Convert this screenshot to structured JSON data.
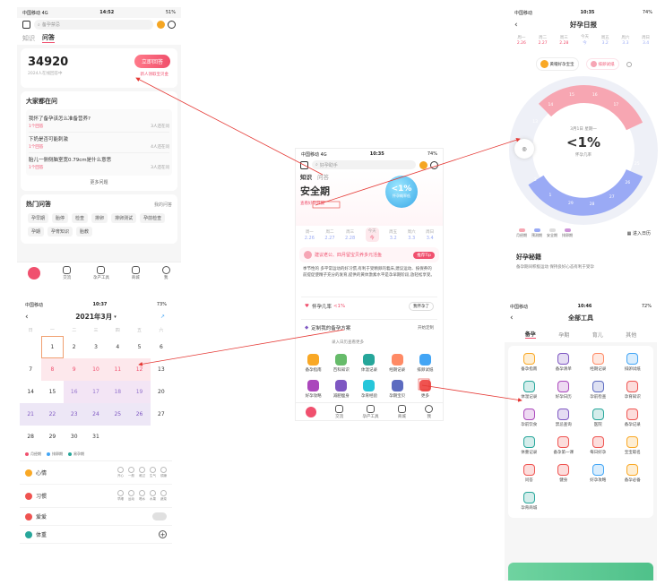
{
  "s1": {
    "status": {
      "carrier": "中国移动 4G",
      "time": "14:52",
      "battery": "51%"
    },
    "search_placeholder": "备孕禁忌",
    "tabs": [
      "知识",
      "问答"
    ],
    "count": "34920",
    "count_sub": "2024人在线回答中",
    "answer_btn": "立即回答",
    "answer_sub": "新人领取宝贝金",
    "ask_title": "大家都在问",
    "questions": [
      {
        "q": "我怀了备孕该怎么准备营养?",
        "meta": "1个回答",
        "tag": "3人还在问"
      },
      {
        "q": "下奶是否可能刺激",
        "meta": "1个回答",
        "tag": "4人还在问"
      },
      {
        "q": "胎儿一侧侧脑室宽0.79cm是什么意思",
        "meta": "1个回答",
        "tag": "3人还在问"
      }
    ],
    "more": "更多问题",
    "hot_title": "热门问答",
    "hot_link": "我的问答",
    "hot_tags": [
      "孕早期",
      "胎停",
      "检查",
      "排卵",
      "排卵测试",
      "孕前检查",
      "孕期",
      "孕育知识",
      "胎教"
    ],
    "tabbar": [
      "交流",
      "孕产工具",
      "商城",
      "我"
    ]
  },
  "s2": {
    "status": {
      "carrier": "中国移动 4G",
      "time": "10:35",
      "battery": "74%"
    },
    "search_placeholder": "好孕助手",
    "tabs": [
      "知识",
      "问答"
    ],
    "phase": "安全期",
    "phase_link": "查看好孕日报",
    "prob": "<1%",
    "prob_sub": "怀孕概率低",
    "dates": [
      {
        "d": "2.26",
        "w": "周一"
      },
      {
        "d": "2.27",
        "w": "周二"
      },
      {
        "d": "2.28",
        "w": "周三"
      },
      {
        "d": "今",
        "w": "今天"
      },
      {
        "d": "3.2",
        "w": "周五"
      },
      {
        "d": "3.3",
        "w": "周六"
      },
      {
        "d": "3.4",
        "w": "周日"
      }
    ],
    "tip": "建议老公、四月留宝贝养多元活鱼",
    "tip_btn": "推荐Tip",
    "article": "季节性的 多平常运动的好习惯,有利于受精卵的着床,建议运动、按保养的前提促使精子充分的发育,提供的黄体激素水平是孕早期阶段,放轻松享受。",
    "row1": {
      "label": "怀孕几率",
      "val": "<1%",
      "btn": "我怀孕了"
    },
    "row2": {
      "label": "定制我的备孕方案",
      "btn": "开始定制"
    },
    "note": "录入日历查看更多",
    "tools": [
      {
        "n": "备孕指南",
        "c": "#f9a825"
      },
      {
        "n": "百科知识",
        "c": "#66bb6a"
      },
      {
        "n": "体温记录",
        "c": "#26a69a"
      },
      {
        "n": "经期记录",
        "c": "#ff8a65"
      },
      {
        "n": "排卵试纸",
        "c": "#42a5f5"
      },
      {
        "n": "好孕攻略",
        "c": "#ab47bc"
      },
      {
        "n": "减肥瘦身",
        "c": "#7e57c2"
      },
      {
        "n": "孕育经验",
        "c": "#26c6da"
      },
      {
        "n": "孕期宝贝",
        "c": "#5c6bc0"
      },
      {
        "n": "更多",
        "c": "#ef5350"
      }
    ],
    "tabbar": [
      "交流",
      "孕产工具",
      "商城",
      "我"
    ]
  },
  "s3": {
    "status": {
      "carrier": "中国移动",
      "time": "10:35",
      "battery": "74%"
    },
    "title": "好孕日报",
    "dates": [
      {
        "w": "周一",
        "d": "2.26"
      },
      {
        "w": "周二",
        "d": "2.27"
      },
      {
        "w": "周三",
        "d": "2.28"
      },
      {
        "w": "今天",
        "d": "今"
      },
      {
        "w": "周五",
        "d": "3.2"
      },
      {
        "w": "周六",
        "d": "3.3"
      },
      {
        "w": "周日",
        "d": "3.4"
      }
    ],
    "toggle_a": "黄帽好孕宝宝",
    "toggle_b": "排卵试纸",
    "center_date": "3月1日 星期一",
    "center_val": "<1%",
    "center_sub": "怀孕几率",
    "ring_nums_top": [
      "13",
      "14",
      "15",
      "16",
      "17"
    ],
    "ring_nums_bottom": [
      "25",
      "26",
      "27",
      "28",
      "29",
      "1",
      "2"
    ],
    "legend": [
      "月经期",
      "预测期",
      "安全期",
      "排卵期"
    ],
    "enter_cal": "进入日历",
    "section": "好孕秘籍",
    "section_text": "备孕期间积极运动 保持良好心态有利于受孕"
  },
  "s4": {
    "status": {
      "carrier": "中国移动",
      "time": "10:37",
      "battery": "73%"
    },
    "month": "2021年3月",
    "week": [
      "日",
      "一",
      "二",
      "三",
      "四",
      "五",
      "六"
    ],
    "days": [
      "",
      "1",
      "2",
      "3",
      "4",
      "5",
      "6",
      "7",
      "8",
      "9",
      "10",
      "11",
      "12",
      "13",
      "14",
      "15",
      "16",
      "17",
      "18",
      "19",
      "20",
      "21",
      "22",
      "23",
      "24",
      "25",
      "26",
      "27",
      "28",
      "29",
      "30",
      "31",
      "",
      "",
      ""
    ],
    "legend": [
      "月经期",
      "排卵期",
      "易孕期"
    ],
    "records": [
      {
        "label": "心情",
        "icon": "#f9a825"
      },
      {
        "label": "习惯",
        "icon": "#ef5350"
      },
      {
        "label": "爱爱",
        "icon": "#ef5350"
      },
      {
        "label": "体重",
        "icon": "#26a69a"
      }
    ],
    "moods": [
      "开心",
      "一般",
      "难过",
      "生气",
      "烦躁"
    ],
    "habits": [
      "早睡",
      "运动",
      "喝水",
      "水果",
      "蔬菜"
    ]
  },
  "s5": {
    "status": {
      "carrier": "中国移动",
      "time": "10:46",
      "battery": "72%"
    },
    "title": "全部工具",
    "tabs": [
      "备孕",
      "孕期",
      "育儿",
      "其他"
    ],
    "tools": [
      {
        "n": "备孕指南",
        "c": "#f9a825"
      },
      {
        "n": "备孕清单",
        "c": "#7e57c2"
      },
      {
        "n": "经期记录",
        "c": "#ff8a65"
      },
      {
        "n": "排卵试纸",
        "c": "#42a5f5"
      },
      {
        "n": "体温记录",
        "c": "#26a69a"
      },
      {
        "n": "好孕日历",
        "c": "#ab47bc"
      },
      {
        "n": "孕前检查",
        "c": "#5c6bc0"
      },
      {
        "n": "孕育知识",
        "c": "#ef5350"
      },
      {
        "n": "孕前饮食",
        "c": "#ab47bc"
      },
      {
        "n": "禁忌查询",
        "c": "#7e57c2"
      },
      {
        "n": "医院",
        "c": "#26a69a"
      },
      {
        "n": "备孕记录",
        "c": "#ef5350"
      },
      {
        "n": "体重记录",
        "c": "#26a69a"
      },
      {
        "n": "备孕第一课",
        "c": "#ef5350"
      },
      {
        "n": "每日好孕",
        "c": "#ef5350"
      },
      {
        "n": "宝宝取名",
        "c": "#f9a825"
      },
      {
        "n": "问答",
        "c": "#ef5350"
      },
      {
        "n": "健身",
        "c": "#ef5350"
      },
      {
        "n": "好孕攻略",
        "c": "#42a5f5"
      },
      {
        "n": "备孕必备",
        "c": "#f9a825"
      },
      {
        "n": "孕育商城",
        "c": "#26a69a"
      }
    ]
  }
}
